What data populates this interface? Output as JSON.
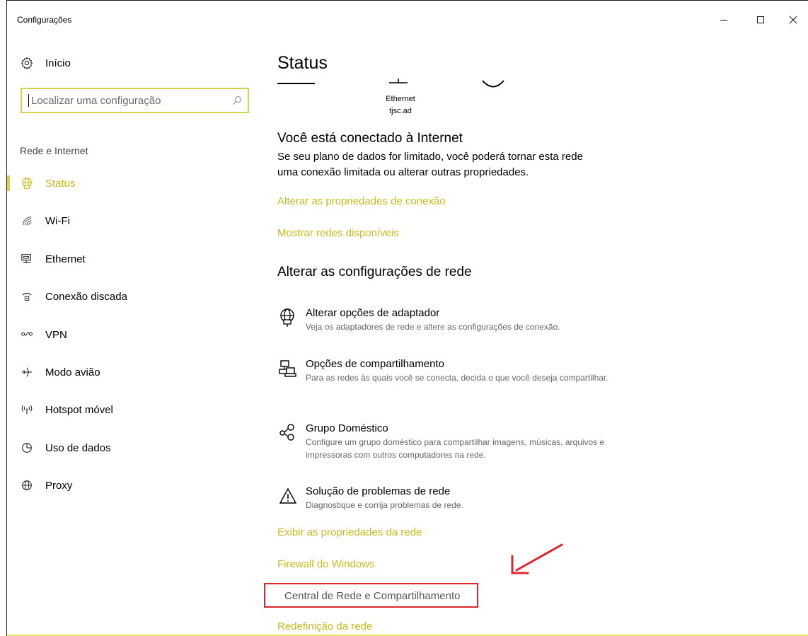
{
  "window": {
    "title": "Configurações"
  },
  "sidebar": {
    "home_label": "Início",
    "search_placeholder": "Localizar uma configuração",
    "section_label": "Rede e Internet",
    "items": [
      {
        "label": "Status",
        "icon": "globe-icon",
        "active": true
      },
      {
        "label": "Wi-Fi",
        "icon": "wifi-icon"
      },
      {
        "label": "Ethernet",
        "icon": "ethernet-icon"
      },
      {
        "label": "Conexão discada",
        "icon": "dialup-icon"
      },
      {
        "label": "VPN",
        "icon": "vpn-icon"
      },
      {
        "label": "Modo avião",
        "icon": "airplane-icon"
      },
      {
        "label": "Hotspot móvel",
        "icon": "hotspot-icon"
      },
      {
        "label": "Uso de dados",
        "icon": "data-usage-icon"
      },
      {
        "label": "Proxy",
        "icon": "proxy-icon"
      }
    ]
  },
  "main": {
    "page_title": "Status",
    "network": {
      "adapter": "Ethernet",
      "domain": "tjsc.ad"
    },
    "connected": {
      "heading": "Você está conectado à Internet",
      "description": "Se seu plano de dados for limitado, você poderá tornar esta rede uma conexão limitada ou alterar outras propriedades."
    },
    "links_top": [
      "Alterar as propriedades de conexão",
      "Mostrar redes disponíveis"
    ],
    "change_heading": "Alterar as configurações de rede",
    "settings": [
      {
        "title": "Alterar opções de adaptador",
        "desc": "Veja os adaptadores de rede e altere as configurações de conexão.",
        "icon": "adapter-icon"
      },
      {
        "title": "Opções de compartilhamento",
        "desc": "Para as redes às quais você se conecta, decida o que você deseja compartilhar.",
        "icon": "sharing-icon"
      },
      {
        "title": "Grupo Doméstico",
        "desc": "Configure um grupo doméstico para compartilhar imagens, músicas, arquivos e impressoras com outros computadores na rede.",
        "icon": "homegroup-icon"
      },
      {
        "title": "Solução de problemas de rede",
        "desc": "Diagnostique e corrija problemas de rede.",
        "icon": "warning-icon"
      }
    ],
    "links_bottom": [
      "Exibir as propriedades da rede",
      "Firewall do Windows",
      "Central de Rede e Compartilhamento",
      "Redefinição da rede"
    ]
  },
  "colors": {
    "accent": "#c5bd1f",
    "highlight": "#e0242b"
  }
}
